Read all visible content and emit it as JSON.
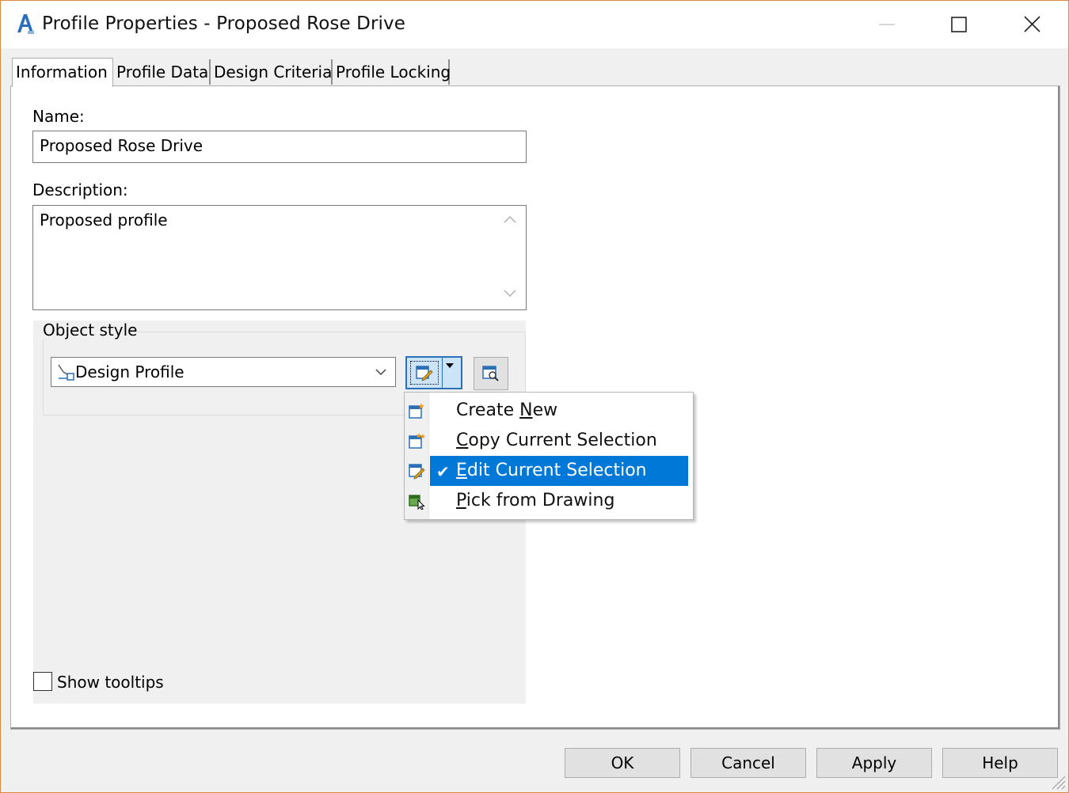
{
  "window": {
    "title": "Profile Properties - Proposed Rose Drive",
    "app_icon": "autocad-civil3d-icon",
    "border_color": "#e0873a"
  },
  "tabs": [
    {
      "label": "Information",
      "active": true
    },
    {
      "label": "Profile Data",
      "active": false
    },
    {
      "label": "Design Criteria",
      "active": false
    },
    {
      "label": "Profile Locking",
      "active": false
    }
  ],
  "info": {
    "name_label": "Name:",
    "name_value": "Proposed Rose Drive",
    "description_label": "Description:",
    "description_value": "Proposed profile",
    "object_style_label": "Object style",
    "object_style_value": "Design Profile",
    "show_tooltips_label": "Show tooltips",
    "show_tooltips_checked": false
  },
  "style_menu": {
    "items": [
      {
        "pre": "Create ",
        "mnemonic": "N",
        "post": "ew",
        "icon": "create-new-style-icon",
        "selected": false
      },
      {
        "pre": "",
        "mnemonic": "C",
        "post": "opy Current Selection",
        "icon": "copy-style-icon",
        "selected": false
      },
      {
        "pre": "",
        "mnemonic": "E",
        "post": "dit Current Selection",
        "icon": "edit-style-icon",
        "selected": true
      },
      {
        "pre": "",
        "mnemonic": "P",
        "post": "ick from Drawing",
        "icon": "pick-from-drawing-icon",
        "selected": false
      }
    ],
    "highlight_color": "#0078d7"
  },
  "buttons": {
    "ok": "OK",
    "cancel": "Cancel",
    "apply": "Apply",
    "help": "Help"
  }
}
